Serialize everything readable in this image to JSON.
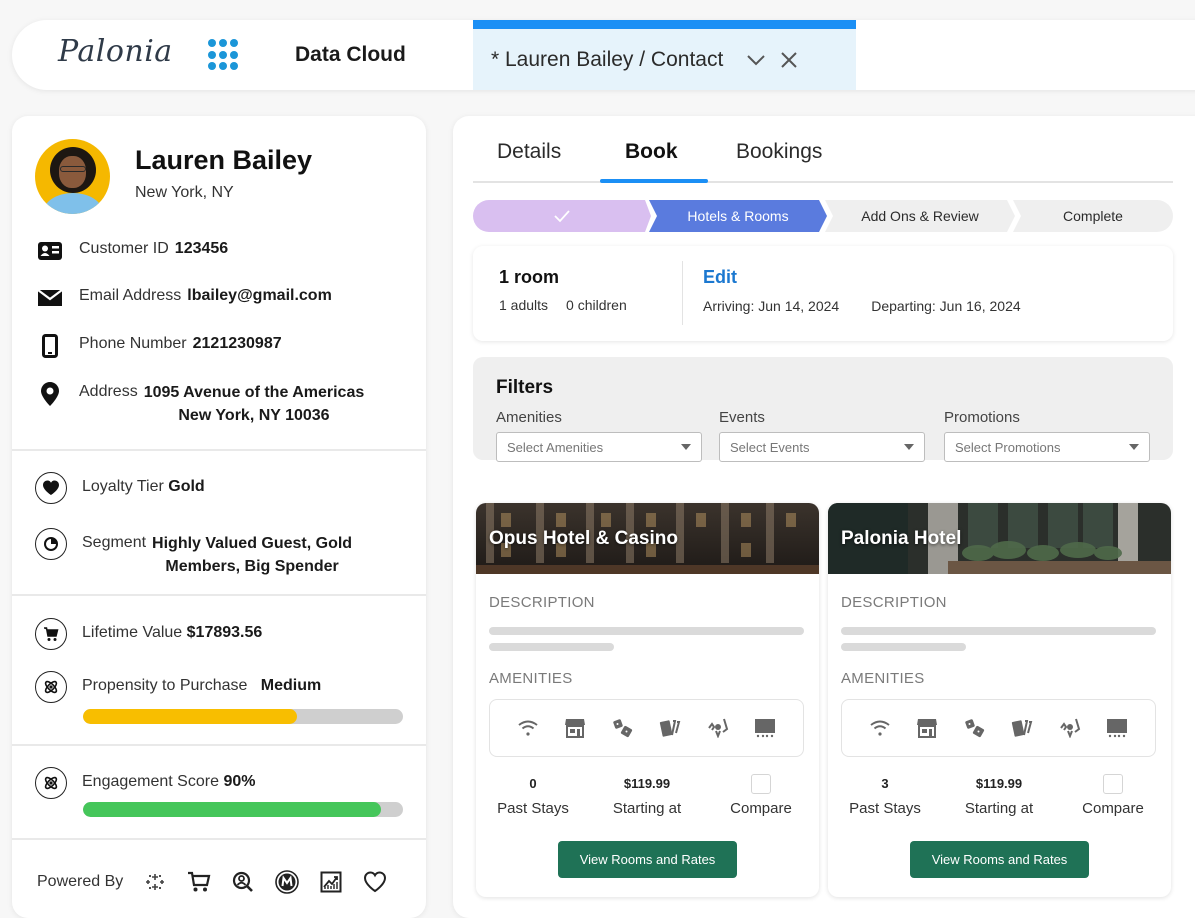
{
  "topbar": {
    "logo": "Palonia",
    "app_launcher_icon": "grid-dots-icon",
    "app_name": "Data Cloud",
    "active_tab": {
      "label": "* Lauren Bailey / Contact",
      "chevron_icon": "chevron-down-icon",
      "close_icon": "close-icon"
    }
  },
  "profile": {
    "name": "Lauren Bailey",
    "location": "New York, NY",
    "fields": [
      {
        "icon": "contact-card-icon",
        "label": "Customer ID",
        "value": "123456"
      },
      {
        "icon": "email-icon",
        "label": "Email Address",
        "value": "lbailey@gmail.com"
      },
      {
        "icon": "phone-icon",
        "label": "Phone Number",
        "value": "2121230987"
      },
      {
        "icon": "location-pin-icon",
        "label": "Address",
        "value_line1": "1095 Avenue of the Americas",
        "value_line2": "New York, NY 10036"
      }
    ],
    "loyalty": {
      "icon": "heart-icon",
      "label": "Loyalty Tier",
      "value": "Gold"
    },
    "segment": {
      "icon": "segment-pie-icon",
      "label": "Segment",
      "value_line1": "Highly Valued Guest, Gold",
      "value_line2": "Members, Big Spender"
    },
    "lifetime_value": {
      "icon": "cart-icon",
      "label": "Lifetime Value",
      "value": "$17893.56"
    },
    "propensity": {
      "icon": "einstein-atom-icon",
      "label": "Propensity to Purchase",
      "value": "Medium",
      "progress_percent": 67,
      "color": "#f8be00"
    },
    "engagement": {
      "icon": "einstein-atom-icon",
      "label": "Engagement Score",
      "value": "90%",
      "progress_percent": 93,
      "color": "#45c65a"
    },
    "powered_by": {
      "label": "Powered By",
      "icons": [
        "tableau-sparkle-icon",
        "commerce-cart-icon",
        "service-search-icon",
        "mulesoft-icon",
        "analytics-chart-icon",
        "loyalty-heart-icon"
      ]
    }
  },
  "booking": {
    "tabs": [
      {
        "label": "Details",
        "active": false
      },
      {
        "label": "Book",
        "active": true
      },
      {
        "label": "Bookings",
        "active": false
      }
    ],
    "path": [
      {
        "label": "",
        "state": "complete",
        "icon": "check-icon"
      },
      {
        "label": "Hotels & Rooms",
        "state": "current"
      },
      {
        "label": "Add Ons & Review",
        "state": "incomplete"
      },
      {
        "label": "Complete",
        "state": "incomplete"
      }
    ],
    "room_summary": {
      "rooms": "1 room",
      "adults": "1 adults",
      "children": "0 children",
      "edit_label": "Edit",
      "arriving": "Arriving: Jun 14, 2024",
      "departing": "Departing: Jun 16, 2024"
    },
    "filters": {
      "title": "Filters",
      "items": [
        {
          "label": "Amenities",
          "placeholder": "Select Amenities"
        },
        {
          "label": "Events",
          "placeholder": "Select Events"
        },
        {
          "label": "Promotions",
          "placeholder": "Select Promotions"
        }
      ]
    },
    "hotels": [
      {
        "name": "Opus Hotel & Casino",
        "description_label": "DESCRIPTION",
        "amenities_label": "AMENITIES",
        "amenity_icons": [
          "wifi-icon",
          "store-icon",
          "dice-icon",
          "cards-icon",
          "entertainment-icon",
          "tv-screen-icon"
        ],
        "past_stays": "0",
        "past_stays_label": "Past Stays",
        "price": "$119.99",
        "price_label": "Starting at",
        "compare_label": "Compare",
        "cta_label": "View Rooms and Rates"
      },
      {
        "name": "Palonia Hotel",
        "description_label": "DESCRIPTION",
        "amenities_label": "AMENITIES",
        "amenity_icons": [
          "wifi-icon",
          "store-icon",
          "dice-icon",
          "cards-icon",
          "entertainment-icon",
          "tv-screen-icon"
        ],
        "past_stays": "3",
        "past_stays_label": "Past Stays",
        "price": "$119.99",
        "price_label": "Starting at",
        "compare_label": "Compare",
        "cta_label": "View Rooms and Rates"
      }
    ]
  }
}
